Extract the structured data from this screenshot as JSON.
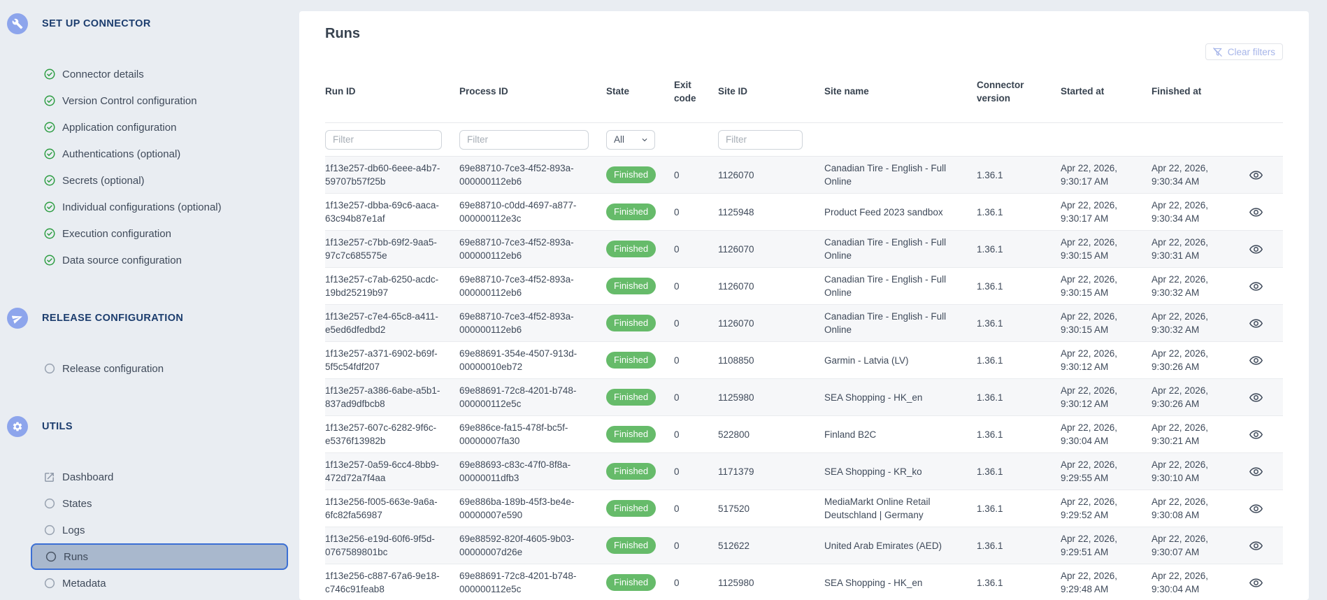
{
  "sidebar": {
    "sections": [
      {
        "title": "SET UP CONNECTOR",
        "icon": "wrench",
        "items": [
          {
            "label": "Connector details",
            "icon": "check-circle"
          },
          {
            "label": "Version Control configuration",
            "icon": "check-circle"
          },
          {
            "label": "Application configuration",
            "icon": "check-circle"
          },
          {
            "label": "Authentications (optional)",
            "icon": "check-circle"
          },
          {
            "label": "Secrets (optional)",
            "icon": "check-circle"
          },
          {
            "label": "Individual configurations (optional)",
            "icon": "check-circle"
          },
          {
            "label": "Execution configuration",
            "icon": "check-circle"
          },
          {
            "label": "Data source configuration",
            "icon": "check-circle"
          }
        ]
      },
      {
        "title": "RELEASE CONFIGURATION",
        "icon": "send",
        "items": [
          {
            "label": "Release configuration",
            "icon": "radio"
          }
        ]
      },
      {
        "title": "UTILS",
        "icon": "gear",
        "items": [
          {
            "label": "Dashboard",
            "icon": "external-link"
          },
          {
            "label": "States",
            "icon": "radio"
          },
          {
            "label": "Logs",
            "icon": "radio"
          },
          {
            "label": "Runs",
            "icon": "radio",
            "selected": true
          },
          {
            "label": "Metadata",
            "icon": "radio"
          }
        ]
      }
    ]
  },
  "main": {
    "title": "Runs",
    "clear_filters_label": "Clear filters",
    "table": {
      "columns": [
        "Run ID",
        "Process ID",
        "State",
        "Exit code",
        "Site ID",
        "Site name",
        "Connector version",
        "Started at",
        "Finished at"
      ],
      "filters": {
        "run_id_placeholder": "Filter",
        "process_id_placeholder": "Filter",
        "state_value": "All",
        "site_id_placeholder": "Filter"
      },
      "rows": [
        {
          "run_id": "1f13e257-db60-6eee-a4b7-59707b57f25b",
          "process_id": "69e88710-7ce3-4f52-893a-000000112eb6",
          "state": "Finished",
          "exit_code": "0",
          "site_id": "1126070",
          "site_name": "Canadian Tire - English - Full Online",
          "connector_version": "1.36.1",
          "started_at": "Apr 22, 2026, 9:30:17 AM",
          "finished_at": "Apr 22, 2026, 9:30:34 AM"
        },
        {
          "run_id": "1f13e257-dbba-69c6-aaca-63c94b87e1af",
          "process_id": "69e88710-c0dd-4697-a877-000000112e3c",
          "state": "Finished",
          "exit_code": "0",
          "site_id": "1125948",
          "site_name": "Product Feed 2023 sandbox",
          "connector_version": "1.36.1",
          "started_at": "Apr 22, 2026, 9:30:17 AM",
          "finished_at": "Apr 22, 2026, 9:30:34 AM"
        },
        {
          "run_id": "1f13e257-c7bb-69f2-9aa5-97c7c685575e",
          "process_id": "69e88710-7ce3-4f52-893a-000000112eb6",
          "state": "Finished",
          "exit_code": "0",
          "site_id": "1126070",
          "site_name": "Canadian Tire - English - Full Online",
          "connector_version": "1.36.1",
          "started_at": "Apr 22, 2026, 9:30:15 AM",
          "finished_at": "Apr 22, 2026, 9:30:31 AM"
        },
        {
          "run_id": "1f13e257-c7ab-6250-acdc-19bd25219b97",
          "process_id": "69e88710-7ce3-4f52-893a-000000112eb6",
          "state": "Finished",
          "exit_code": "0",
          "site_id": "1126070",
          "site_name": "Canadian Tire - English - Full Online",
          "connector_version": "1.36.1",
          "started_at": "Apr 22, 2026, 9:30:15 AM",
          "finished_at": "Apr 22, 2026, 9:30:32 AM"
        },
        {
          "run_id": "1f13e257-c7e4-65c8-a411-e5ed6dfedbd2",
          "process_id": "69e88710-7ce3-4f52-893a-000000112eb6",
          "state": "Finished",
          "exit_code": "0",
          "site_id": "1126070",
          "site_name": "Canadian Tire - English - Full Online",
          "connector_version": "1.36.1",
          "started_at": "Apr 22, 2026, 9:30:15 AM",
          "finished_at": "Apr 22, 2026, 9:30:32 AM"
        },
        {
          "run_id": "1f13e257-a371-6902-b69f-5f5c54fdf207",
          "process_id": "69e88691-354e-4507-913d-00000010eb72",
          "state": "Finished",
          "exit_code": "0",
          "site_id": "1108850",
          "site_name": "Garmin - Latvia (LV)",
          "connector_version": "1.36.1",
          "started_at": "Apr 22, 2026, 9:30:12 AM",
          "finished_at": "Apr 22, 2026, 9:30:26 AM"
        },
        {
          "run_id": "1f13e257-a386-6abe-a5b1-837ad9dfbcb8",
          "process_id": "69e88691-72c8-4201-b748-000000112e5c",
          "state": "Finished",
          "exit_code": "0",
          "site_id": "1125980",
          "site_name": "SEA Shopping - HK_en",
          "connector_version": "1.36.1",
          "started_at": "Apr 22, 2026, 9:30:12 AM",
          "finished_at": "Apr 22, 2026, 9:30:26 AM"
        },
        {
          "run_id": "1f13e257-607c-6282-9f6c-e5376f13982b",
          "process_id": "69e886ce-fa15-478f-bc5f-00000007fa30",
          "state": "Finished",
          "exit_code": "0",
          "site_id": "522800",
          "site_name": "Finland B2C",
          "connector_version": "1.36.1",
          "started_at": "Apr 22, 2026, 9:30:04 AM",
          "finished_at": "Apr 22, 2026, 9:30:21 AM"
        },
        {
          "run_id": "1f13e257-0a59-6cc4-8bb9-472d72a7f4aa",
          "process_id": "69e88693-c83c-47f0-8f8a-00000011dfb3",
          "state": "Finished",
          "exit_code": "0",
          "site_id": "1171379",
          "site_name": "SEA Shopping - KR_ko",
          "connector_version": "1.36.1",
          "started_at": "Apr 22, 2026, 9:29:55 AM",
          "finished_at": "Apr 22, 2026, 9:30:10 AM"
        },
        {
          "run_id": "1f13e256-f005-663e-9a6a-6fc82fa56987",
          "process_id": "69e886ba-189b-45f3-be4e-00000007e590",
          "state": "Finished",
          "exit_code": "0",
          "site_id": "517520",
          "site_name": "MediaMarkt Online Retail Deutschland | Germany",
          "connector_version": "1.36.1",
          "started_at": "Apr 22, 2026, 9:29:52 AM",
          "finished_at": "Apr 22, 2026, 9:30:08 AM"
        },
        {
          "run_id": "1f13e256-e19d-60f6-9f5d-0767589801bc",
          "process_id": "69e88592-820f-4605-9b03-00000007d26e",
          "state": "Finished",
          "exit_code": "0",
          "site_id": "512622",
          "site_name": "United Arab Emirates (AED)",
          "connector_version": "1.36.1",
          "started_at": "Apr 22, 2026, 9:29:51 AM",
          "finished_at": "Apr 22, 2026, 9:30:07 AM"
        },
        {
          "run_id": "1f13e256-c887-67a6-9e18-c746c91feab8",
          "process_id": "69e88691-72c8-4201-b748-000000112e5c",
          "state": "Finished",
          "exit_code": "0",
          "site_id": "1125980",
          "site_name": "SEA Shopping - HK_en",
          "connector_version": "1.36.1",
          "started_at": "Apr 22, 2026, 9:29:48 AM",
          "finished_at": "Apr 22, 2026, 9:30:04 AM"
        }
      ]
    }
  },
  "colors": {
    "status_finished": "#66bb6a",
    "selected_item_border": "#3b6fd4",
    "selected_item_bg": "#a9b8cd",
    "section_icon_circle": "#8da5ec",
    "check_green": "#2f9e44",
    "sidebar_header_text": "#1c3d6e"
  }
}
